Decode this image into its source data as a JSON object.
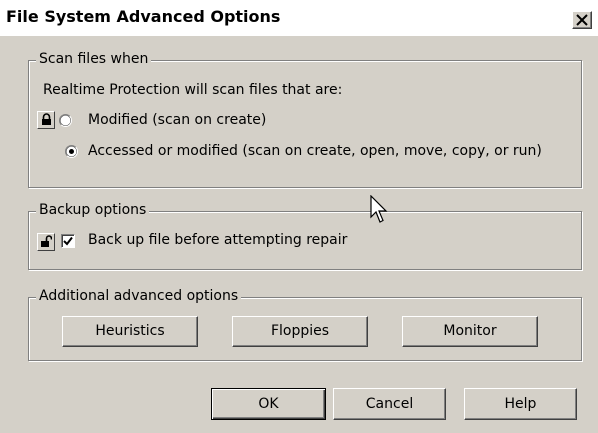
{
  "window": {
    "title": "File System Advanced Options",
    "close_icon": "close-icon"
  },
  "scan_group": {
    "legend": "Scan files when",
    "description": "Realtime Protection will scan files that are:",
    "lock_icon": "lock-closed-icon",
    "options": [
      {
        "label": "Modified (scan on create)",
        "selected": false
      },
      {
        "label": "Accessed or modified (scan on create, open, move, copy, or run)",
        "selected": true
      }
    ]
  },
  "backup_group": {
    "legend": "Backup options",
    "lock_icon": "lock-open-icon",
    "checkbox_label": "Back up file before attempting repair",
    "checked": true
  },
  "advanced_group": {
    "legend": "Additional advanced options",
    "buttons": [
      "Heuristics",
      "Floppies",
      "Monitor"
    ]
  },
  "footer": {
    "ok": "OK",
    "cancel": "Cancel",
    "help": "Help"
  },
  "colors": {
    "dialog_bg": "#d4d0c8",
    "titlebar_bg": "#ffffff"
  }
}
